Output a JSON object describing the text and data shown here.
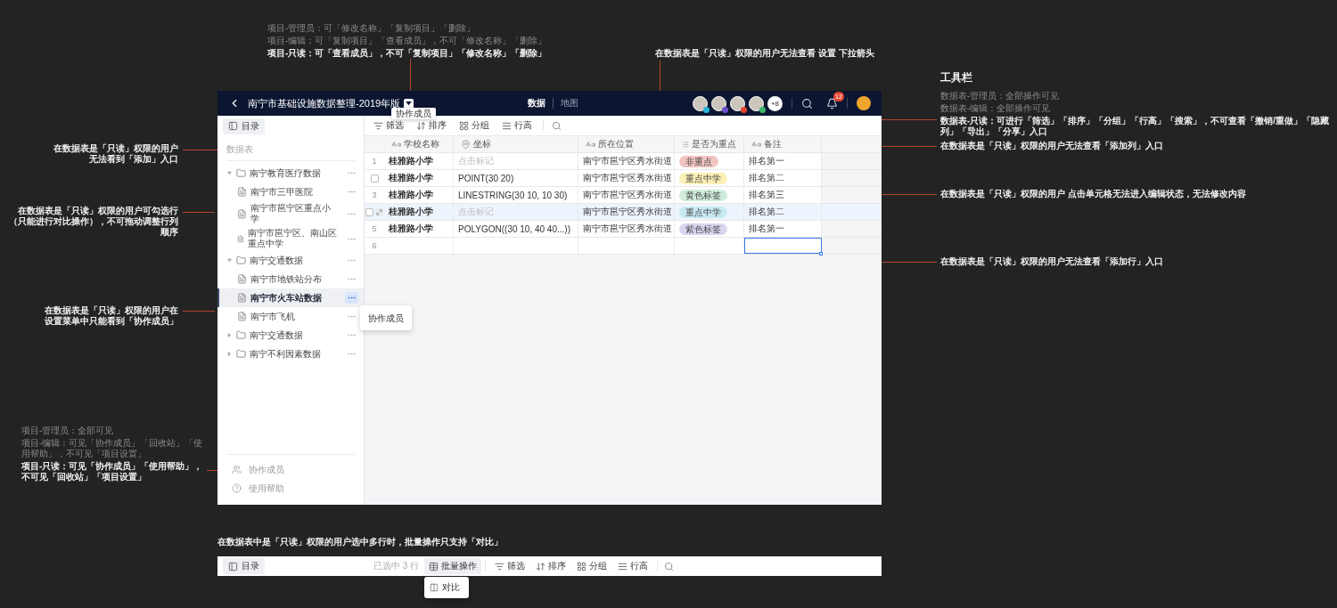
{
  "annotations": [
    {
      "lines": [
        {
          "text": "项目-管理员：可「修改名称」「复制项目」「删除」",
          "highlighted": false
        },
        {
          "text": "项目-编辑：可「复制项目」「查看成员」，不可「修改名称」「删除」",
          "highlighted": false
        },
        {
          "text": "项目-只读：可「查看成员」，不可「复制项目」「修改名称」「删除」",
          "highlighted": true
        }
      ]
    },
    {
      "lines": [
        {
          "text": "在数据表是「只读」权限的用户无法查看 设置 下拉箭头",
          "highlighted": true
        }
      ]
    },
    {
      "title": "工具栏",
      "lines": [
        {
          "text": "数据表-管理员：全部操作可见",
          "highlighted": false
        },
        {
          "text": "数据表-编辑：全部操作可见",
          "highlighted": false
        },
        {
          "text": "数据表-只读：可进行「筛选」「排序」「分组」「行高」「搜索」，不可查看「撤销/重做」「隐藏列」「导出」「分享」入口",
          "highlighted": true
        }
      ]
    },
    {
      "lines": [
        {
          "text": "在数据表是「只读」权限的用户无法查看「添加列」入口",
          "highlighted": true
        }
      ]
    },
    {
      "lines": [
        {
          "text": "在数据表是「只读」权限的用户 点击单元格无法进入编辑状态，无法修改内容",
          "highlighted": true
        }
      ]
    },
    {
      "lines": [
        {
          "text": "在数据表是「只读」权限的用户无法查看「添加行」入口",
          "highlighted": true
        }
      ]
    },
    {
      "lines": [
        {
          "text": "在数据表是「只读」权限的用户无法看到「添加」入口",
          "highlighted": true
        }
      ]
    },
    {
      "lines": [
        {
          "text": "在数据表是「只读」权限的用户可勾选行（只能进行对比操作），不可拖动调整行列顺序",
          "highlighted": true
        }
      ]
    },
    {
      "lines": [
        {
          "text": "在数据表是「只读」权限的用户在设置菜单中只能看到「协作成员」",
          "highlighted": true
        }
      ]
    },
    {
      "lines": [
        {
          "text": "项目-管理员：全部可见",
          "highlighted": false
        },
        {
          "text": "项目-编辑：可见「协作成员」「回收站」「使用帮助」，不可见「项目设置」",
          "highlighted": false
        },
        {
          "text": "项目-只读：可见「协作成员」「使用帮助」，不可见「回收站」「项目设置」",
          "highlighted": true
        }
      ]
    },
    {
      "lines": [
        {
          "text": "在数据表中是「只读」权限的用户选中多行时，批量操作只支持「对比」",
          "highlighted": true
        }
      ]
    }
  ],
  "app": {
    "title": "南宁市基础设施数据整理-2019年版",
    "title_tooltip": "协作成员",
    "view_tabs": [
      {
        "label": "数据",
        "selected": true
      },
      {
        "label": "地图",
        "selected": false
      }
    ],
    "members": [
      {
        "color": "#2bb5d8"
      },
      {
        "color": "#6b4fd1"
      },
      {
        "color": "#e8452c"
      },
      {
        "color": "#3db86b"
      }
    ],
    "members_more": "+8",
    "notifications": "12",
    "sidebar": {
      "toggle": "目录",
      "section": "数据表",
      "tree": [
        {
          "kind": "folder",
          "label": "南宁教育医疗数据",
          "expanded": true,
          "selected": false,
          "children": [
            {
              "kind": "sheet",
              "label": "南宁市三甲医院",
              "selected": false
            },
            {
              "kind": "sheet",
              "label": "南宁市邕宁区重点小学",
              "selected": false
            },
            {
              "kind": "sheet",
              "label": "南宁市邕宁区、南山区重点中学",
              "selected": false
            }
          ]
        },
        {
          "kind": "folder",
          "label": "南宁交通数据",
          "expanded": true,
          "selected": false,
          "children": [
            {
              "kind": "sheet",
              "label": "南宁市地铁站分布",
              "selected": false
            },
            {
              "kind": "sheet",
              "label": "南宁市火车站数据",
              "selected": true
            },
            {
              "kind": "sheet",
              "label": "南宁市飞机",
              "selected": false
            }
          ]
        },
        {
          "kind": "folder",
          "label": "南宁交通数据",
          "expanded": false,
          "selected": false
        },
        {
          "kind": "folder",
          "label": "南宁不利因素数据",
          "expanded": false,
          "selected": false
        }
      ],
      "item_menu": [
        "协作成员"
      ],
      "footer": [
        {
          "kind": "members",
          "label": "协作成员"
        },
        {
          "kind": "help",
          "label": "使用帮助"
        }
      ]
    },
    "toolbar": [
      {
        "kind": "filter",
        "label": "筛选"
      },
      {
        "kind": "sort",
        "label": "排序"
      },
      {
        "kind": "group",
        "label": "分组"
      },
      {
        "kind": "row_height",
        "label": "行高"
      },
      {
        "kind": "search"
      }
    ],
    "table": {
      "columns": [
        {
          "kind": "text",
          "label": "学校名称"
        },
        {
          "kind": "location",
          "label": "坐标"
        },
        {
          "kind": "text",
          "label": "所在位置"
        },
        {
          "kind": "option",
          "label": "是否为重点"
        },
        {
          "kind": "text",
          "label": "备注"
        }
      ],
      "rows": [
        {
          "marker": {
            "kind": "number",
            "text": "1"
          },
          "hovered": false,
          "school": "桂雅路小学",
          "coordinate": {
            "kind": "placeholder",
            "text": "点击标记"
          },
          "address": "南宁市邕宁区秀水街道",
          "priority": {
            "label": "非重点",
            "color": "#f2c4c1"
          },
          "note": "排名第一"
        },
        {
          "marker": {
            "kind": "checkbox"
          },
          "hovered": false,
          "school": "桂雅路小学",
          "coordinate": {
            "kind": "value",
            "text": "POINT(30 20)"
          },
          "address": "南宁市邕宁区秀水街道",
          "priority": {
            "label": "重点中学",
            "color": "#fbf0b5"
          },
          "note": "排名第二"
        },
        {
          "marker": {
            "kind": "number",
            "text": "3"
          },
          "hovered": false,
          "school": "桂雅路小学",
          "coordinate": {
            "kind": "value",
            "text": "LINESTRING(30 10, 10 30)"
          },
          "address": "南宁市邕宁区秀水街道",
          "priority": {
            "label": "黄色标签",
            "color": "#d0ecdb"
          },
          "note": "排名第三"
        },
        {
          "marker": {
            "kind": "checkbox"
          },
          "hovered": true,
          "school": "桂雅路小学",
          "coordinate": {
            "kind": "placeholder",
            "text": "点击标记"
          },
          "address": "南宁市邕宁区秀水街道",
          "priority": {
            "label": "重点中学",
            "color": "#c8eaf3"
          },
          "note": "排名第二"
        },
        {
          "marker": {
            "kind": "number",
            "text": "5"
          },
          "hovered": false,
          "school": "桂雅路小学",
          "coordinate": {
            "kind": "value",
            "text": "POLYGON((30 10, 40 40...))"
          },
          "address": "南宁市邕宁区秀水街道",
          "priority": {
            "label": "紫色标签",
            "color": "#dcd5f0"
          },
          "note": "排名第一"
        }
      ],
      "new_row": {
        "number": "6",
        "note_selected": true
      }
    }
  },
  "selection_toolbar": {
    "toggle": "目录",
    "selected_count": "已选中 3 行",
    "batch": {
      "label": "批量操作",
      "menu": [
        "对比"
      ]
    },
    "tools": [
      {
        "kind": "filter",
        "label": "筛选"
      },
      {
        "kind": "sort",
        "label": "排序"
      },
      {
        "kind": "group",
        "label": "分组"
      },
      {
        "kind": "row_height",
        "label": "行高"
      },
      {
        "kind": "search"
      }
    ]
  }
}
